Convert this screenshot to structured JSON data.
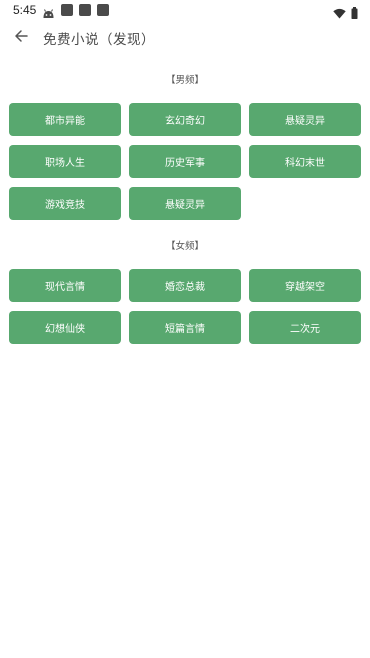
{
  "status_bar": {
    "time": "5:45",
    "icons": [
      "android-debug-icon",
      "notification-icon",
      "notification-icon",
      "notification-icon",
      "wifi-icon",
      "battery-icon"
    ]
  },
  "app_bar": {
    "title": "免费小说（发现）",
    "back_icon": "back-arrow-icon"
  },
  "sections": [
    {
      "title": "【男频】",
      "categories": [
        "都市异能",
        "玄幻奇幻",
        "悬疑灵异",
        "职场人生",
        "历史军事",
        "科幻末世",
        "游戏竞技",
        "悬疑灵异"
      ]
    },
    {
      "title": "【女频】",
      "categories": [
        "现代言情",
        "婚恋总裁",
        "穿越架空",
        "幻想仙侠",
        "短篇言情",
        "二次元"
      ]
    }
  ],
  "colors": {
    "chip_background": "#58a86f",
    "chip_text": "#ffffff",
    "background": "#ffffff"
  }
}
